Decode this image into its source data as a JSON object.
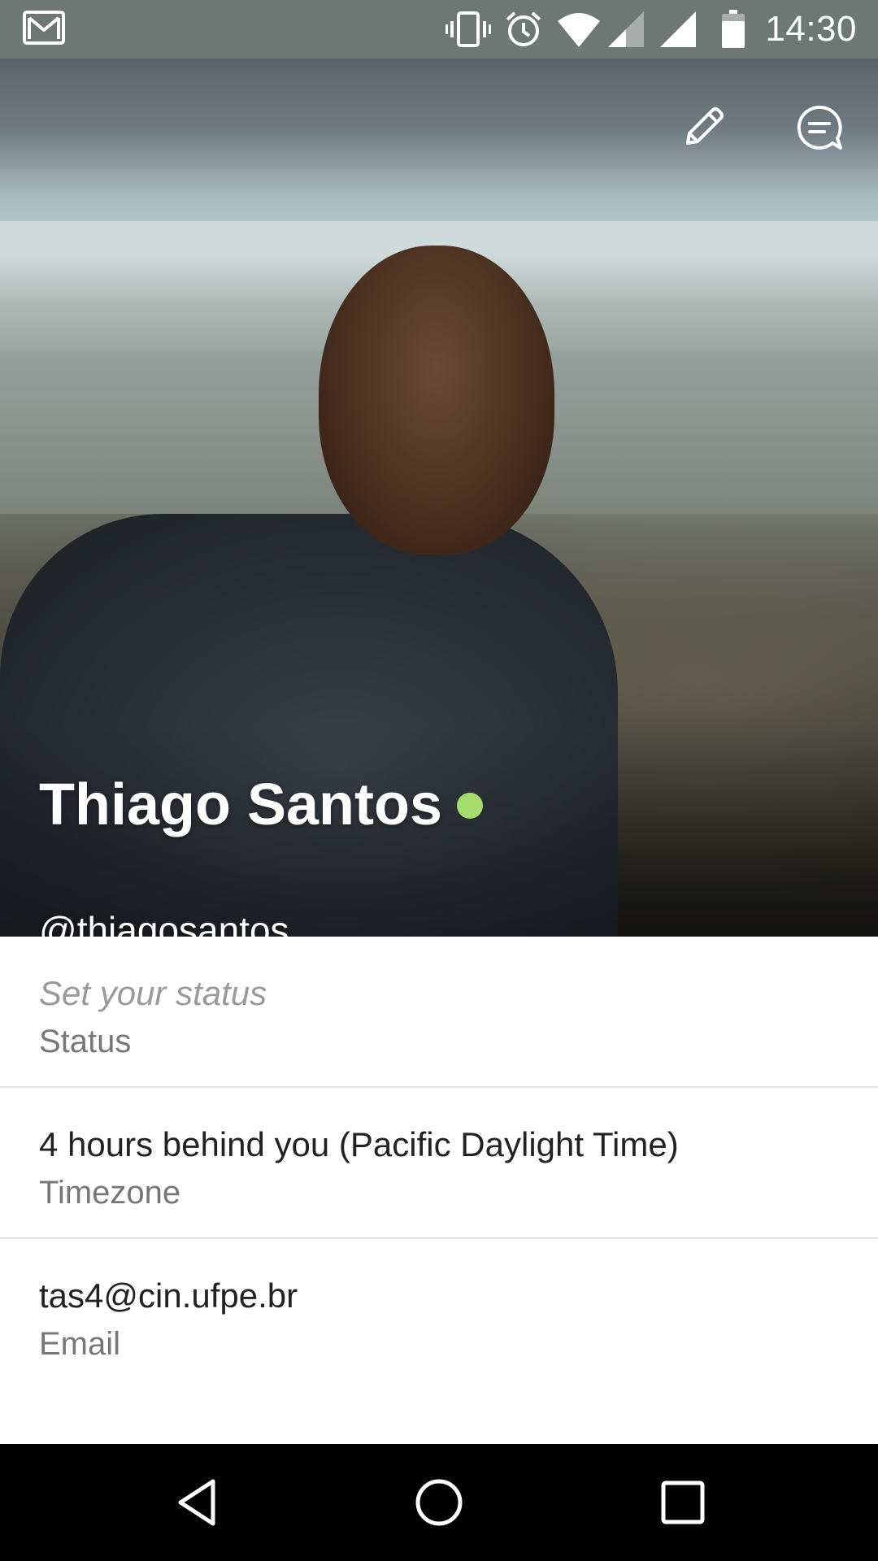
{
  "status_bar": {
    "time": "14:30",
    "icons": [
      "gmail-icon",
      "vibrate-icon",
      "alarm-icon",
      "wifi-icon",
      "signal-icon",
      "signal-icon",
      "battery-icon"
    ]
  },
  "profile": {
    "name": "Thiago Santos",
    "handle": "@thiagosantos",
    "presence": "online",
    "presence_color": "#a6dc6e",
    "actions": [
      "edit-icon",
      "message-icon"
    ]
  },
  "details": [
    {
      "value": "Set your status",
      "label": "Status"
    },
    {
      "value": "4 hours behind you (Pacific Daylight Time)",
      "label": "Timezone"
    },
    {
      "value": "tas4@cin.ufpe.br",
      "label": "Email"
    }
  ],
  "nav_bar": {
    "buttons": [
      "back-icon",
      "home-icon",
      "recents-icon"
    ]
  },
  "colors": {
    "status_bar_bg": "#6d7774",
    "nav_bar_bg": "#000000",
    "divider": "#e3e3e3",
    "placeholder_text": "#9a9a9a",
    "label_text": "#777777"
  }
}
